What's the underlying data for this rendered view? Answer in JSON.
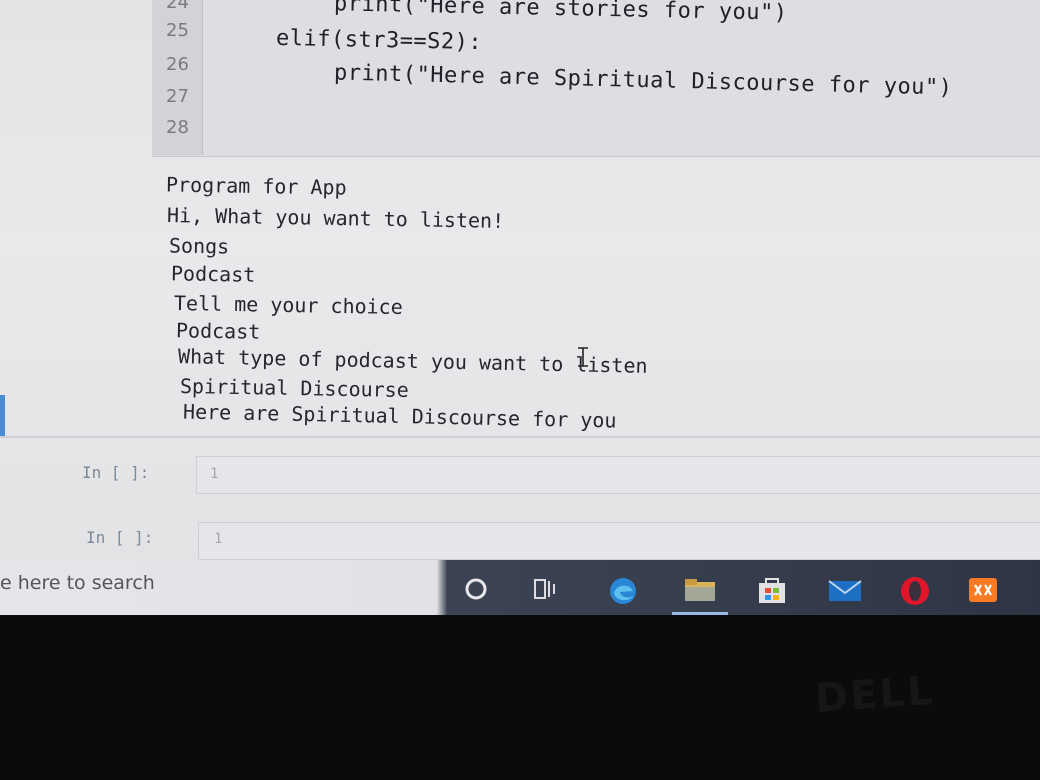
{
  "code_cell": {
    "line_numbers": [
      "24",
      "25",
      "26",
      "27",
      "28"
    ],
    "lines": [
      {
        "text": "print(\"Here are stories for you\")"
      },
      {
        "text": "elif(str3==S2):"
      },
      {
        "text": "print(\"Here are Spiritual Discourse for you\")"
      }
    ]
  },
  "output": {
    "lines": [
      "Program for App",
      "Hi, What you want to listen!",
      "Songs",
      "Podcast",
      "Tell me your choice",
      "Podcast",
      "What type of podcast you want to listen",
      "Spiritual Discourse",
      "Here are Spiritual Discourse for you"
    ]
  },
  "empty_cells": [
    {
      "prompt": "In [ ]:",
      "line_number": "1"
    },
    {
      "prompt": "In [ ]:",
      "line_number": "1"
    }
  ],
  "taskbar": {
    "search_text": "e here to search",
    "icons": [
      "cortana-icon",
      "task-view-icon",
      "edge-icon",
      "file-explorer-icon",
      "store-icon",
      "mail-icon",
      "opera-icon",
      "xampp-icon"
    ]
  },
  "bezel": {
    "brand": "DELL"
  },
  "colors": {
    "accent": "#4a8bd6",
    "taskbar_dark": "#2f3544",
    "string": "#b02020",
    "keyword": "#1a6a1a"
  }
}
